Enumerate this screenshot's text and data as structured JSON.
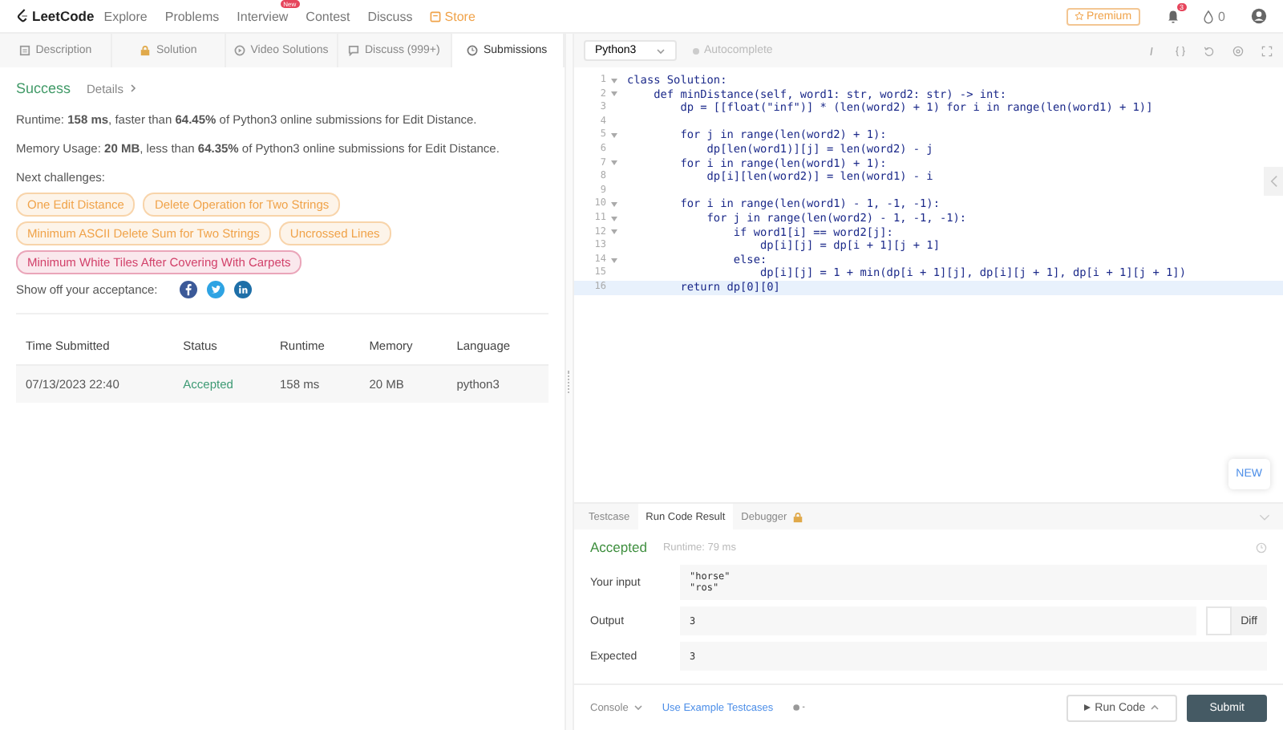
{
  "nav": {
    "logo": "LeetCode",
    "items": [
      {
        "label": "Explore",
        "highlight": false
      },
      {
        "label": "Problems",
        "highlight": false
      },
      {
        "label": "Interview",
        "badge": "New",
        "highlight": false
      },
      {
        "label": "Contest",
        "highlight": false
      },
      {
        "label": "Discuss",
        "highlight": false
      },
      {
        "label": "Store",
        "highlight": true
      }
    ],
    "premium": "Premium",
    "notifications": "3",
    "points": "0"
  },
  "tabs": [
    {
      "label": "Description",
      "selected": false
    },
    {
      "label": "Solution",
      "selected": false
    },
    {
      "label": "Video Solutions",
      "selected": false
    },
    {
      "label": "Discuss (999+)",
      "selected": false
    },
    {
      "label": "Submissions",
      "selected": true
    }
  ],
  "result": {
    "status": "Success",
    "details": "Details",
    "runtime": "Runtime: **158 ms**, faster than **64.45%** of Python3 online submissions for Edit Distance.",
    "memory": "Memory Usage: **20 MB**, less than **64.35%** of Python3 online submissions for Edit Distance.",
    "next_label": "Next challenges:",
    "challenges": [
      {
        "label": "One Edit Distance",
        "color": "#f0a34a"
      },
      {
        "label": "Delete Operation for Two Strings",
        "color": "#f0a34a"
      },
      {
        "label": "Minimum ASCII Delete Sum for Two Strings",
        "color": "#f0a34a"
      },
      {
        "label": "Uncrossed Lines",
        "color": "#f0a34a"
      },
      {
        "label": "Minimum White Tiles After Covering With Carpets",
        "color": "#d2426b"
      }
    ],
    "share_label": "Show off your acceptance:"
  },
  "table": {
    "columns": [
      "Time Submitted",
      "Status",
      "Runtime",
      "Memory",
      "Language"
    ],
    "rows": [
      {
        "cells": [
          "07/13/2023 22:40",
          "Accepted",
          "158 ms",
          "20 MB",
          "python3"
        ],
        "accepted": true
      }
    ]
  },
  "editor": {
    "language": "Python3",
    "autocomplete": "Autocomplete",
    "autocomplete_on": false,
    "lines": [
      {
        "n": "1",
        "text": "class Solution:",
        "fold": true,
        "current": false
      },
      {
        "n": "2",
        "text": "    def minDistance(self, word1: str, word2: str) -> int:",
        "fold": true,
        "current": false
      },
      {
        "n": "3",
        "text": "        dp = [[float(\"inf\")] * (len(word2) + 1) for i in range(len(word1) + 1)]",
        "fold": false,
        "current": false
      },
      {
        "n": "4",
        "fold": false,
        "current": false
      },
      {
        "n": "5",
        "text": "        for j in range(len(word2) + 1):",
        "fold": true,
        "current": false
      },
      {
        "n": "6",
        "text": "            dp[len(word1)][j] = len(word2) - j",
        "fold": false,
        "current": false
      },
      {
        "n": "7",
        "text": "        for i in range(len(word1) + 1):",
        "fold": true,
        "current": false
      },
      {
        "n": "8",
        "text": "            dp[i][len(word2)] = len(word1) - i",
        "fold": false,
        "current": false
      },
      {
        "n": "9",
        "fold": false,
        "current": false
      },
      {
        "n": "10",
        "text": "        for i in range(len(word1) - 1, -1, -1):",
        "fold": true,
        "current": false
      },
      {
        "n": "11",
        "text": "            for j in range(len(word2) - 1, -1, -1):",
        "fold": true,
        "current": false
      },
      {
        "n": "12",
        "text": "                if word1[i] == word2[j]:",
        "fold": true,
        "current": false
      },
      {
        "n": "13",
        "text": "                    dp[i][j] = dp[i + 1][j + 1]",
        "fold": false,
        "current": false
      },
      {
        "n": "14",
        "text": "                else:",
        "fold": true,
        "current": false
      },
      {
        "n": "15",
        "text": "                    dp[i][j] = 1 + min(dp[i + 1][j], dp[i][j + 1], dp[i + 1][j + 1])",
        "fold": false,
        "current": false
      },
      {
        "n": "16",
        "text": "        return dp[0][0]",
        "fold": false,
        "current": true
      }
    ],
    "new_badge": "NEW"
  },
  "console": {
    "tabs": [
      {
        "label": "Testcase",
        "locked": false,
        "selected": false
      },
      {
        "label": "Run Code Result",
        "locked": false,
        "selected": true
      },
      {
        "label": "Debugger",
        "locked": true,
        "selected": false
      }
    ],
    "status": "Accepted",
    "runtime": "Runtime: 79 ms",
    "rows": [
      {
        "label": "Your input",
        "values": [
          "\"horse\"",
          "\"ros\""
        ]
      },
      {
        "label": "Output",
        "values": [
          "3"
        ],
        "diff": "Diff"
      },
      {
        "label": "Expected",
        "values": [
          "3"
        ]
      }
    ],
    "diff_on": false,
    "footer": {
      "console": "Console",
      "examples": "Use Example Testcases",
      "run": "Run Code",
      "submit": "Submit"
    }
  }
}
